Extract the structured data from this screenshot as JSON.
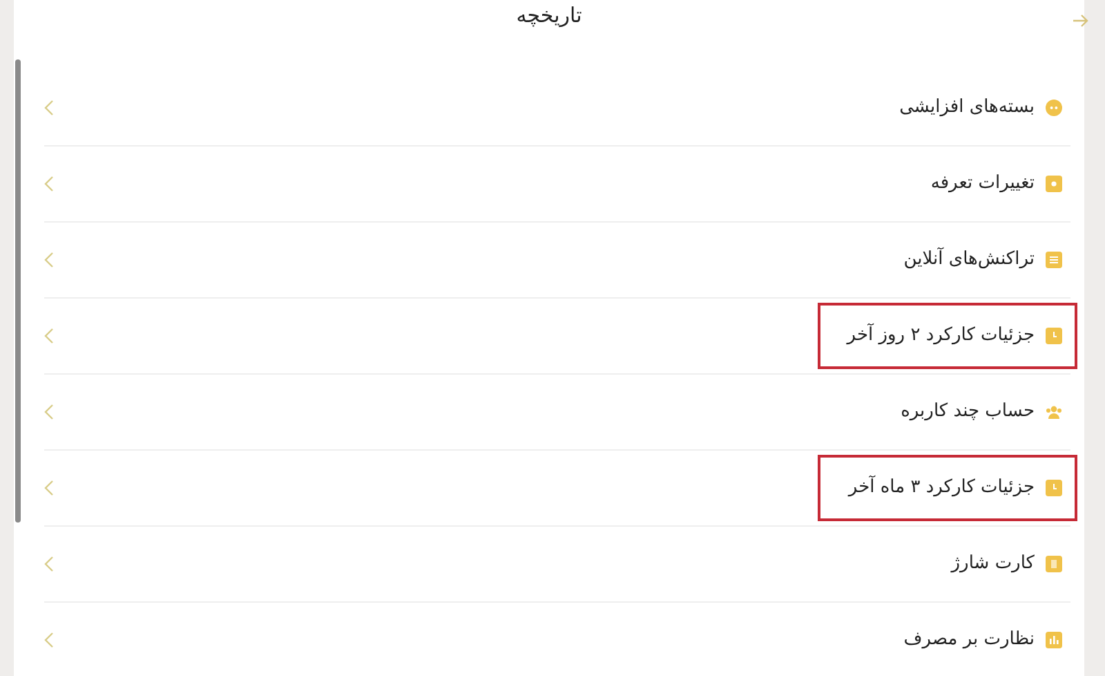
{
  "header": {
    "title": "تاریخچه"
  },
  "items": [
    {
      "label": "بسته‌های افزایشی",
      "highlighted": false
    },
    {
      "label": "تغییرات تعرفه",
      "highlighted": false
    },
    {
      "label": "تراکنش‌های آنلاین",
      "highlighted": false
    },
    {
      "label": "جزئیات کارکرد ۲ روز آخر",
      "highlighted": true
    },
    {
      "label": "حساب چند کاربره",
      "highlighted": false
    },
    {
      "label": "جزئیات کارکرد ۳ ماه آخر",
      "highlighted": true
    },
    {
      "label": "کارت شارژ",
      "highlighted": false
    },
    {
      "label": "نظارت بر مصرف",
      "highlighted": false
    }
  ]
}
